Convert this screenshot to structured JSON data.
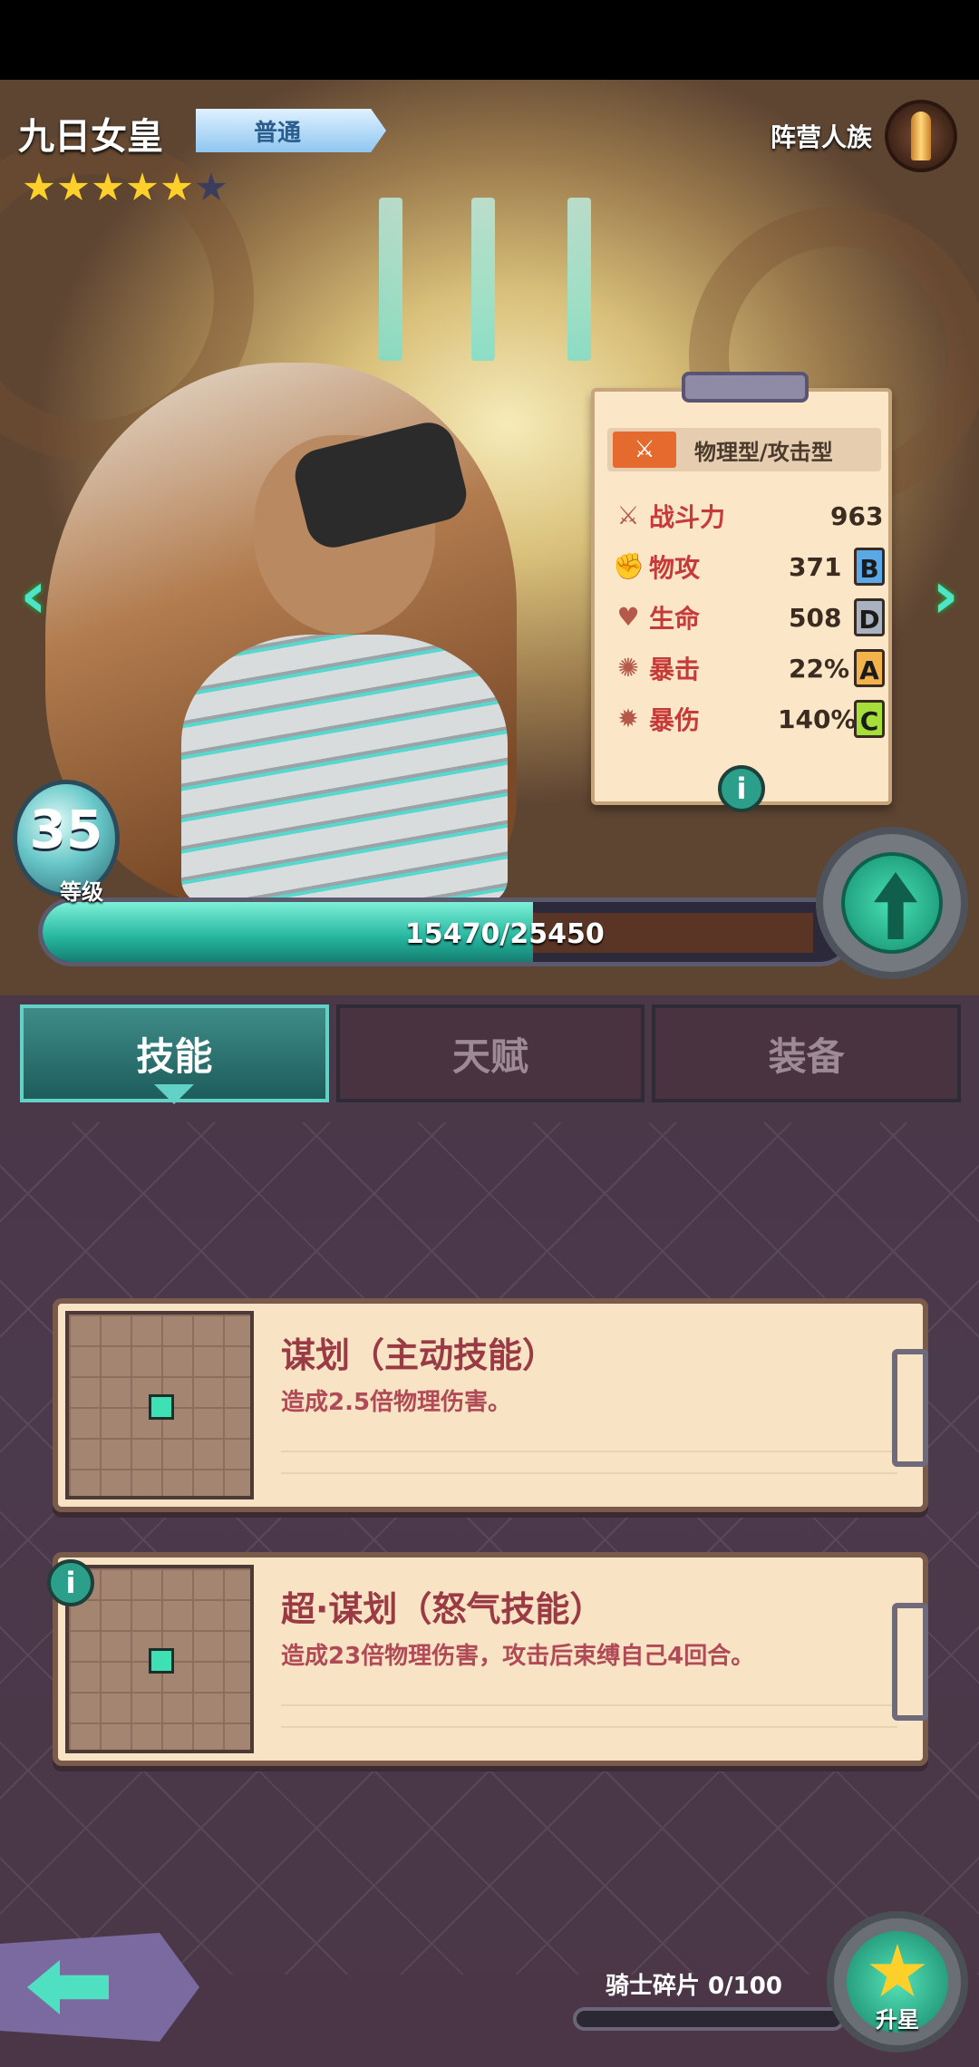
{
  "hero": {
    "name": "九日女皇",
    "rarity": "普通",
    "stars_filled": 5,
    "stars_total": 6,
    "faction": "阵营人族",
    "faction_icon": "bullet-icon"
  },
  "stats_card": {
    "type": "物理型/攻击型",
    "stats": [
      {
        "icon": "combat-power-icon",
        "label": "战斗力",
        "value": "963",
        "grade": ""
      },
      {
        "icon": "attack-icon",
        "label": "物攻",
        "value": "371",
        "grade": "B",
        "grade_color": "#5aa9e6"
      },
      {
        "icon": "heart-icon",
        "label": "生命",
        "value": "508",
        "grade": "D",
        "grade_color": "#a9b2c0"
      },
      {
        "icon": "crit-icon",
        "label": "暴击",
        "value": "22%",
        "grade": "A",
        "grade_color": "#f1b34a"
      },
      {
        "icon": "crit-damage-icon",
        "label": "暴伤",
        "value": "140%",
        "grade": "C",
        "grade_color": "#a6de3a"
      }
    ]
  },
  "level": {
    "value": "35",
    "label": "等级",
    "xp_text": "15470/25450",
    "xp_current": 15470,
    "xp_max": 25450
  },
  "tabs": [
    {
      "label": "技能",
      "active": true
    },
    {
      "label": "天赋",
      "active": false
    },
    {
      "label": "装备",
      "active": false
    }
  ],
  "skills": [
    {
      "title": "谋划（主动技能）",
      "desc": "造成2.5倍物理伤害。"
    },
    {
      "title": "超·谋划（怒气技能）",
      "desc": "造成23倍物理伤害，攻击后束缚自己4回合。"
    }
  ],
  "bottom": {
    "shards_label": "骑士碎片 0/100",
    "star_button_label": "升星"
  },
  "colors": {
    "accent": "#3fe0b4",
    "skill_text": "#b04a56"
  }
}
